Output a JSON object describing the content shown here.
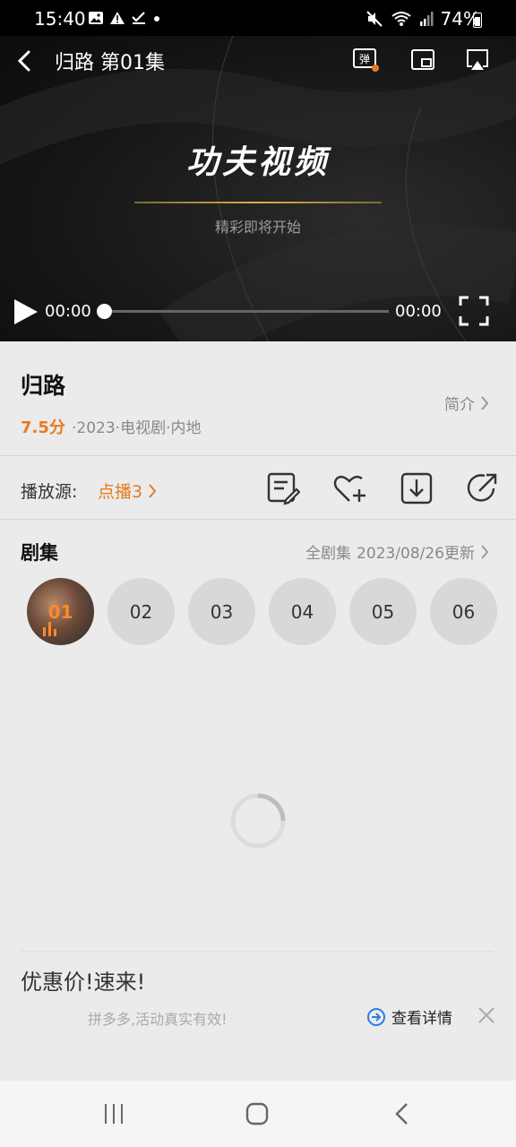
{
  "status_bar": {
    "time": "15:40",
    "battery": "74%"
  },
  "player": {
    "header_title": "归路 第01集",
    "danmaku_label": "弹",
    "logo_text": "功夫视频",
    "logo_sub": "精彩即将开始",
    "time_current": "00:00",
    "time_total": "00:00",
    "progress": 0
  },
  "info": {
    "title": "归路",
    "score": "7.5分",
    "meta": "·2023·电视剧·内地",
    "intro_label": "简介"
  },
  "source": {
    "label": "播放源:",
    "value": "点播3"
  },
  "episodes": {
    "title": "剧集",
    "all_label": "全剧集",
    "update_label": "2023/08/26更新",
    "items": [
      "01",
      "02",
      "03",
      "04",
      "05",
      "06"
    ],
    "current_index": 0
  },
  "ad": {
    "title": "优惠价!速来!",
    "subtitle": "拼多多,活动真实有效!",
    "detail_label": "查看详情"
  },
  "colors": {
    "accent": "#e87b22",
    "player_bg": "#161616",
    "page_bg": "#ebebeb"
  }
}
